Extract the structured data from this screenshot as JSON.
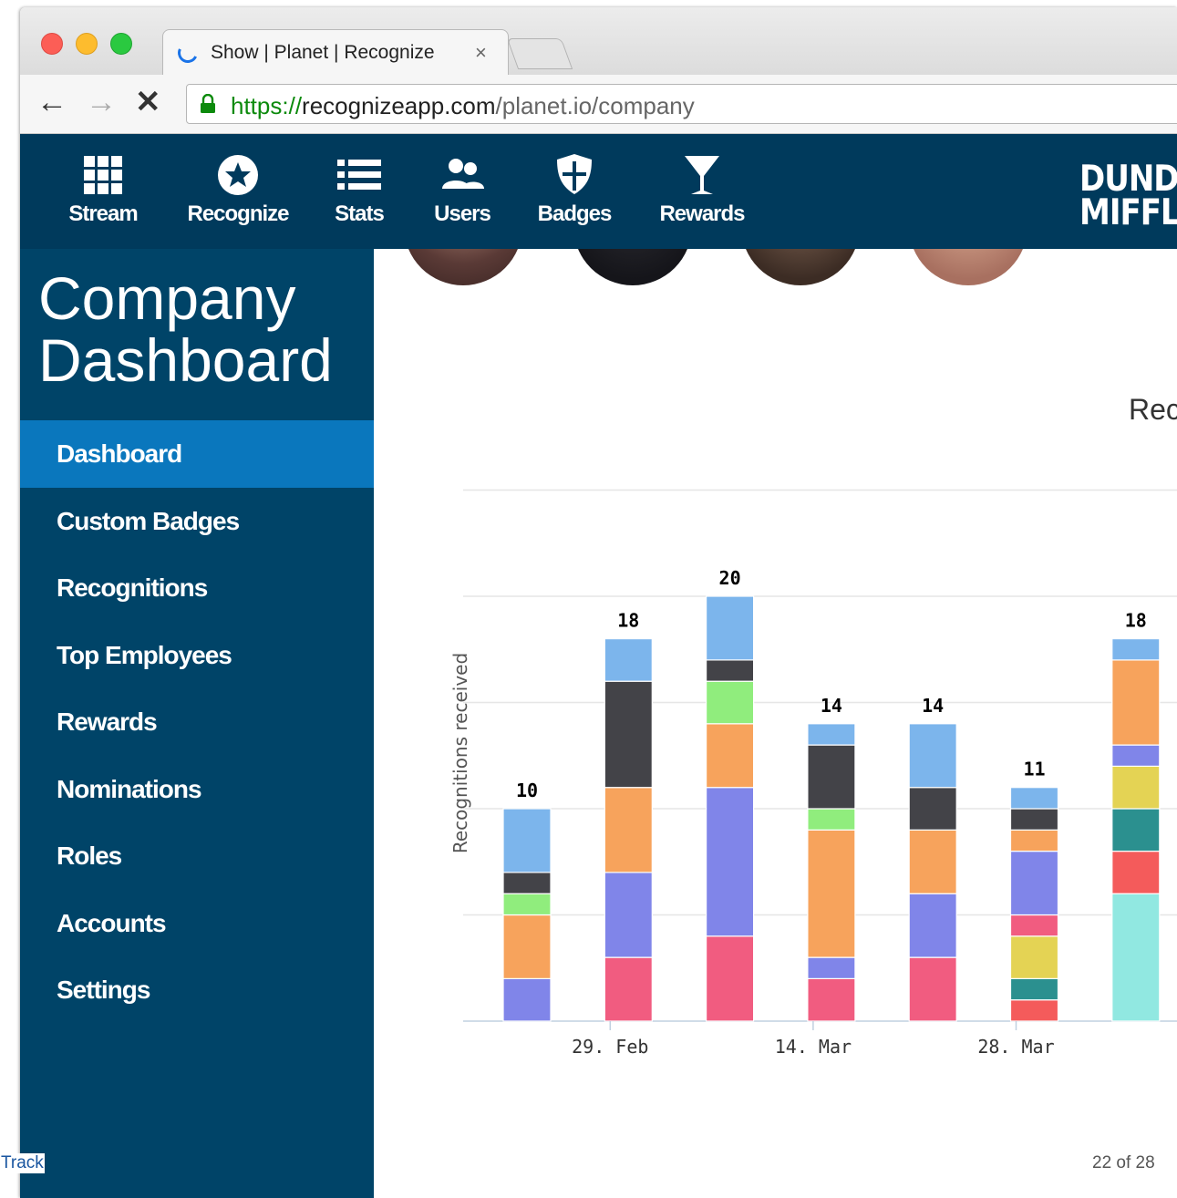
{
  "browser": {
    "tab_title": "Show | Planet | Recognize",
    "tab_close": "×",
    "url_scheme": "https://",
    "url_host": "recognizeapp.com",
    "url_path": "/planet.io/company"
  },
  "nav": {
    "items": [
      {
        "label": "Stream",
        "icon": "grid-icon"
      },
      {
        "label": "Recognize",
        "icon": "star-circle-icon"
      },
      {
        "label": "Stats",
        "icon": "list-icon"
      },
      {
        "label": "Users",
        "icon": "users-icon"
      },
      {
        "label": "Badges",
        "icon": "shield-icon"
      },
      {
        "label": "Rewards",
        "icon": "cocktail-icon"
      }
    ],
    "brand": "DUNDI\nMIFFL"
  },
  "sidebar": {
    "title_line1": "Company",
    "title_line2": "Dashboard",
    "items": [
      {
        "label": "Dashboard",
        "active": true
      },
      {
        "label": "Custom Badges"
      },
      {
        "label": "Recognitions"
      },
      {
        "label": "Top Employees"
      },
      {
        "label": "Rewards"
      },
      {
        "label": "Nominations"
      },
      {
        "label": "Roles"
      },
      {
        "label": "Accounts"
      },
      {
        "label": "Settings"
      }
    ]
  },
  "chart_data": {
    "type": "bar",
    "stacked": true,
    "title": "Rec",
    "ylabel": "Recognitions received",
    "xlabel": "",
    "ylim": [
      0,
      20
    ],
    "grid": true,
    "x_tick_labels": [
      "29. Feb",
      "14. Mar",
      "28. Mar"
    ],
    "totals": [
      10,
      18,
      20,
      14,
      14,
      11,
      18
    ],
    "colors": [
      "#f15c80",
      "#8085e9",
      "#f7a35c",
      "#90ed7d",
      "#434348",
      "#7cb5ec",
      "#f45b5b",
      "#2b908f",
      "#e4d354",
      "#91e8e1"
    ],
    "bars": [
      {
        "segments": [
          [
            1,
            2
          ],
          [
            2,
            3
          ],
          [
            3,
            1
          ],
          [
            4,
            1
          ],
          [
            5,
            3
          ]
        ]
      },
      {
        "segments": [
          [
            0,
            3
          ],
          [
            1,
            4
          ],
          [
            2,
            4
          ],
          [
            4,
            5
          ],
          [
            5,
            2
          ]
        ]
      },
      {
        "segments": [
          [
            0,
            4
          ],
          [
            1,
            7
          ],
          [
            2,
            3
          ],
          [
            3,
            2
          ],
          [
            4,
            1
          ],
          [
            5,
            3
          ]
        ]
      },
      {
        "segments": [
          [
            0,
            2
          ],
          [
            1,
            1
          ],
          [
            2,
            6
          ],
          [
            3,
            1
          ],
          [
            4,
            3
          ],
          [
            5,
            1
          ]
        ]
      },
      {
        "segments": [
          [
            0,
            3
          ],
          [
            1,
            3
          ],
          [
            2,
            3
          ],
          [
            4,
            2
          ],
          [
            5,
            3
          ]
        ]
      },
      {
        "segments": [
          [
            6,
            1
          ],
          [
            7,
            1
          ],
          [
            8,
            2
          ],
          [
            0,
            1
          ],
          [
            1,
            3
          ],
          [
            2,
            1
          ],
          [
            4,
            1
          ],
          [
            5,
            1
          ]
        ]
      },
      {
        "segments": [
          [
            9,
            6
          ],
          [
            6,
            2
          ],
          [
            7,
            2
          ],
          [
            8,
            2
          ],
          [
            1,
            1
          ],
          [
            2,
            4
          ],
          [
            5,
            1
          ]
        ]
      }
    ]
  },
  "footer": {
    "track_link": "Track",
    "page_count": "22 of 28"
  }
}
